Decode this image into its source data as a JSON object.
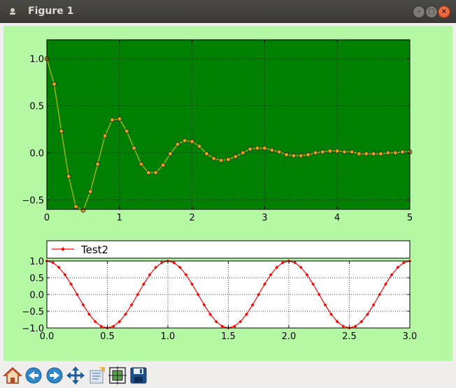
{
  "window": {
    "title": "Figure 1"
  },
  "colors": {
    "figure_bg": "#b4f8a3",
    "top_axes_bg": "#008000",
    "top_line": "#bdbd00",
    "top_marker": "#d4a017",
    "bottom_line": "#ff0000"
  },
  "toolbar": {
    "buttons": [
      {
        "name": "home-icon"
      },
      {
        "name": "back-icon"
      },
      {
        "name": "forward-icon"
      },
      {
        "name": "pan-icon"
      },
      {
        "name": "zoom-icon"
      },
      {
        "name": "configure-subplots-icon"
      },
      {
        "name": "save-icon"
      }
    ]
  },
  "chart_data": [
    {
      "type": "line",
      "title": "",
      "xlabel": "",
      "ylabel": "",
      "xlim": [
        0,
        5
      ],
      "ylim": [
        -0.6,
        1.2
      ],
      "xticks": [
        "0",
        "1",
        "2",
        "3",
        "4",
        "5"
      ],
      "yticks": [
        "1.0",
        "0.5",
        "0.0",
        "−0.5"
      ],
      "grid": true,
      "legend": "none",
      "series": [
        {
          "x": [
            0.0,
            0.1,
            0.2,
            0.3,
            0.4,
            0.5,
            0.6,
            0.7,
            0.8,
            0.9,
            1.0,
            1.1,
            1.2,
            1.3,
            1.4,
            1.5,
            1.6,
            1.7,
            1.8,
            1.9,
            2.0,
            2.1,
            2.2,
            2.3,
            2.4,
            2.5,
            2.6,
            2.7,
            2.8,
            2.9,
            3.0,
            3.1,
            3.2,
            3.3,
            3.4,
            3.5,
            3.6,
            3.7,
            3.8,
            3.9,
            4.0,
            4.1,
            4.2,
            4.3,
            4.4,
            4.5,
            4.6,
            4.7,
            4.8,
            4.9,
            5.0
          ],
          "y": [
            1.0,
            0.73,
            0.23,
            -0.25,
            -0.57,
            -0.61,
            -0.41,
            -0.12,
            0.18,
            0.35,
            0.36,
            0.23,
            0.05,
            -0.12,
            -0.21,
            -0.21,
            -0.13,
            -0.01,
            0.09,
            0.13,
            0.12,
            0.07,
            -0.01,
            -0.06,
            -0.08,
            -0.07,
            -0.04,
            0.0,
            0.04,
            0.05,
            0.05,
            0.03,
            0.01,
            -0.02,
            -0.03,
            -0.03,
            -0.02,
            0.0,
            0.01,
            0.02,
            0.02,
            0.01,
            0.01,
            -0.01,
            -0.01,
            -0.01,
            -0.01,
            0.0,
            0.0,
            0.01,
            0.01
          ]
        }
      ]
    },
    {
      "type": "line",
      "title": "",
      "xlabel": "",
      "ylabel": "",
      "xlim": [
        0.0,
        3.0
      ],
      "ylim": [
        -1.0,
        1.0
      ],
      "xticks": [
        "0.0",
        "0.5",
        "1.0",
        "1.5",
        "2.0",
        "2.5",
        "3.0"
      ],
      "yticks": [
        "1.0",
        "0.5",
        "0.0",
        "−0.5",
        "−1.0"
      ],
      "grid": true,
      "legend": "top, outside",
      "series": [
        {
          "name": "Test2",
          "x": [
            0.0,
            0.05,
            0.1,
            0.15,
            0.2,
            0.25,
            0.3,
            0.35,
            0.4,
            0.45,
            0.5,
            0.55,
            0.6,
            0.65,
            0.7,
            0.75,
            0.8,
            0.85,
            0.9,
            0.95,
            1.0,
            1.05,
            1.1,
            1.15,
            1.2,
            1.25,
            1.3,
            1.35,
            1.4,
            1.45,
            1.5,
            1.55,
            1.6,
            1.65,
            1.7,
            1.75,
            1.8,
            1.85,
            1.9,
            1.95,
            2.0,
            2.05,
            2.1,
            2.15,
            2.2,
            2.25,
            2.3,
            2.35,
            2.4,
            2.45,
            2.5,
            2.55,
            2.6,
            2.65,
            2.7,
            2.75,
            2.8,
            2.85,
            2.9,
            2.95,
            3.0
          ],
          "y": [
            1.0,
            0.95,
            0.81,
            0.59,
            0.31,
            0.0,
            -0.31,
            -0.59,
            -0.81,
            -0.95,
            -1.0,
            -0.95,
            -0.81,
            -0.59,
            -0.31,
            0.0,
            0.31,
            0.59,
            0.81,
            0.95,
            1.0,
            0.95,
            0.81,
            0.59,
            0.31,
            0.0,
            -0.31,
            -0.59,
            -0.81,
            -0.95,
            -1.0,
            -0.95,
            -0.81,
            -0.59,
            -0.31,
            0.0,
            0.31,
            0.59,
            0.81,
            0.95,
            1.0,
            0.95,
            0.81,
            0.59,
            0.31,
            0.0,
            -0.31,
            -0.59,
            -0.81,
            -0.95,
            -1.0,
            -0.95,
            -0.81,
            -0.59,
            -0.31,
            0.0,
            0.31,
            0.59,
            0.81,
            0.95,
            1.0
          ]
        }
      ]
    }
  ]
}
